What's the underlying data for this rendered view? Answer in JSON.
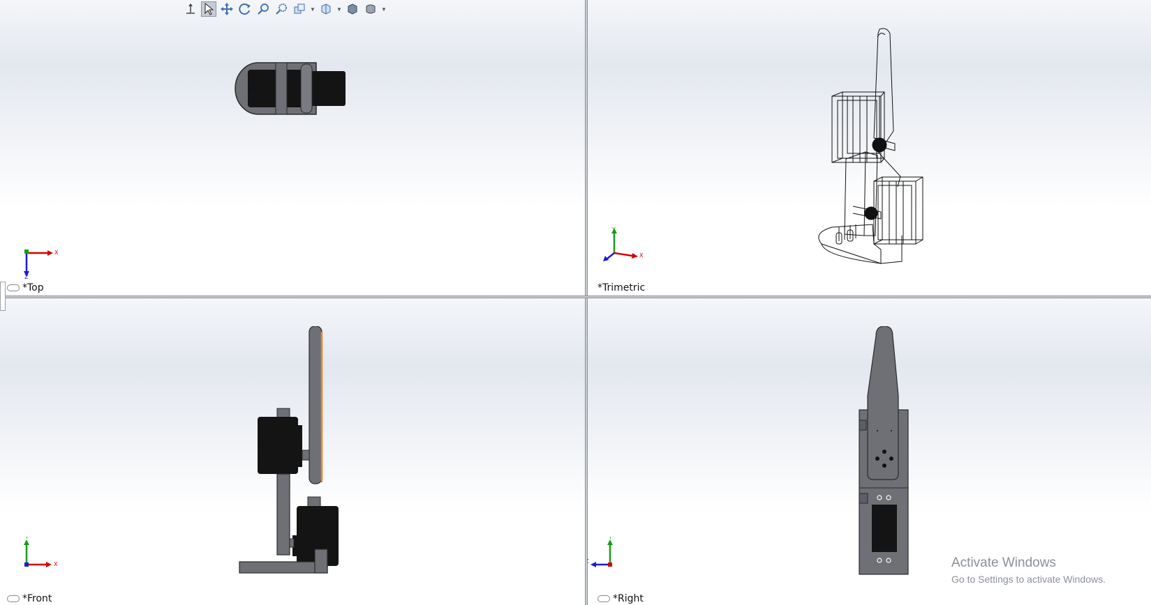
{
  "toolbar": {
    "tools": [
      "orient-icon",
      "select-icon",
      "pan-icon",
      "rotate-icon",
      "zoom-to-fit-icon",
      "zoom-to-area-icon",
      "previous-view-icon",
      "view-orientation-icon",
      "display-style-icon",
      "section-view-icon",
      "hide-show-items-icon"
    ]
  },
  "views": {
    "top": {
      "label": "*Top"
    },
    "trimetric": {
      "label": "*Trimetric"
    },
    "front": {
      "label": "*Front"
    },
    "right": {
      "label": "*Right"
    }
  },
  "axes": {
    "x": "X",
    "y": "Y",
    "z": "Z"
  },
  "watermark": {
    "title": "Activate Windows",
    "subtitle": "Go to Settings to activate Windows."
  },
  "colors": {
    "part_gray": "#6f7076",
    "servo_black": "#141414",
    "edge_dark": "#2a2a2a",
    "accent_orange": "#e8892a",
    "axis_x": "#d40000",
    "axis_y": "#1a9a1a",
    "axis_z": "#1a1ad4"
  }
}
